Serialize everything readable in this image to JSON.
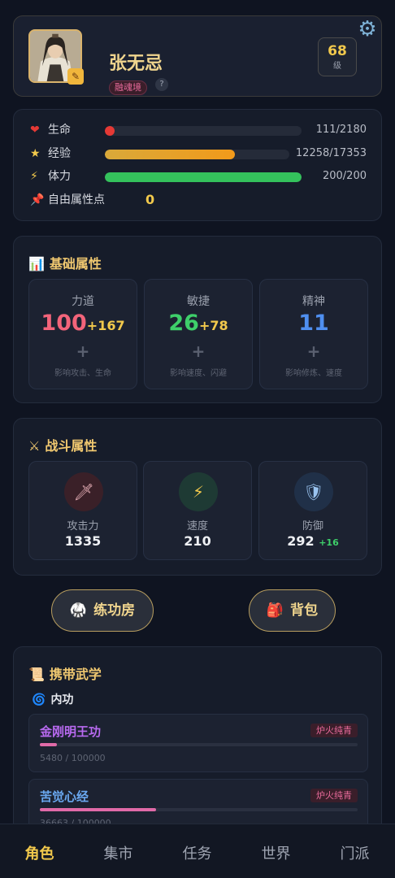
{
  "profile": {
    "name": "张无忌",
    "realm": "融魂境",
    "help": "?",
    "level": "68",
    "level_unit": "级"
  },
  "stats": {
    "health": {
      "label": "生命",
      "value": "111/2180",
      "fraction": 0.051,
      "color": "#e53935"
    },
    "exp": {
      "label": "经验",
      "value": "12258/17353",
      "fraction": 0.706
    },
    "stamina": {
      "label": "体力",
      "value": "200/200",
      "fraction": 1.0,
      "color": "#34c25c"
    },
    "free_points": {
      "label": "自由属性点",
      "value": "0"
    }
  },
  "base_attributes": {
    "title": "基础属性",
    "items": [
      {
        "name": "力道",
        "base": "100",
        "bonus": "+167",
        "plus": "+",
        "desc": "影响攻击、生命",
        "color": "#f2647a"
      },
      {
        "name": "敏捷",
        "base": "26",
        "bonus": "+78",
        "plus": "+",
        "desc": "影响速度、闪避",
        "color": "#3ecf6a"
      },
      {
        "name": "精神",
        "base": "11",
        "bonus": "",
        "plus": "+",
        "desc": "影响修炼、速度",
        "color": "#4f8ff0"
      }
    ]
  },
  "combat_attributes": {
    "title": "战斗属性",
    "items": [
      {
        "name": "攻击力",
        "value": "1335",
        "bonus": "",
        "icon": "sword-icon"
      },
      {
        "name": "速度",
        "value": "210",
        "bonus": "",
        "icon": "lightning-icon"
      },
      {
        "name": "防御",
        "value": "292",
        "bonus": "+16",
        "icon": "shield-icon"
      }
    ]
  },
  "actions": {
    "training_room": "练功房",
    "backpack": "背包"
  },
  "martial_arts": {
    "title": "携带武学",
    "subsection": "内功",
    "skills": [
      {
        "name": "金刚明王功",
        "tag": "炉火纯青",
        "progress": "5480 / 100000",
        "fraction": 0.0548,
        "color": "#b86af0"
      },
      {
        "name": "苦觉心经",
        "tag": "炉火纯青",
        "progress": "36663 / 100000",
        "fraction": 0.3666,
        "color": "#6aa8f0"
      }
    ]
  },
  "nav": {
    "items": [
      "角色",
      "集市",
      "任务",
      "世界",
      "门派"
    ],
    "active": "角色"
  }
}
